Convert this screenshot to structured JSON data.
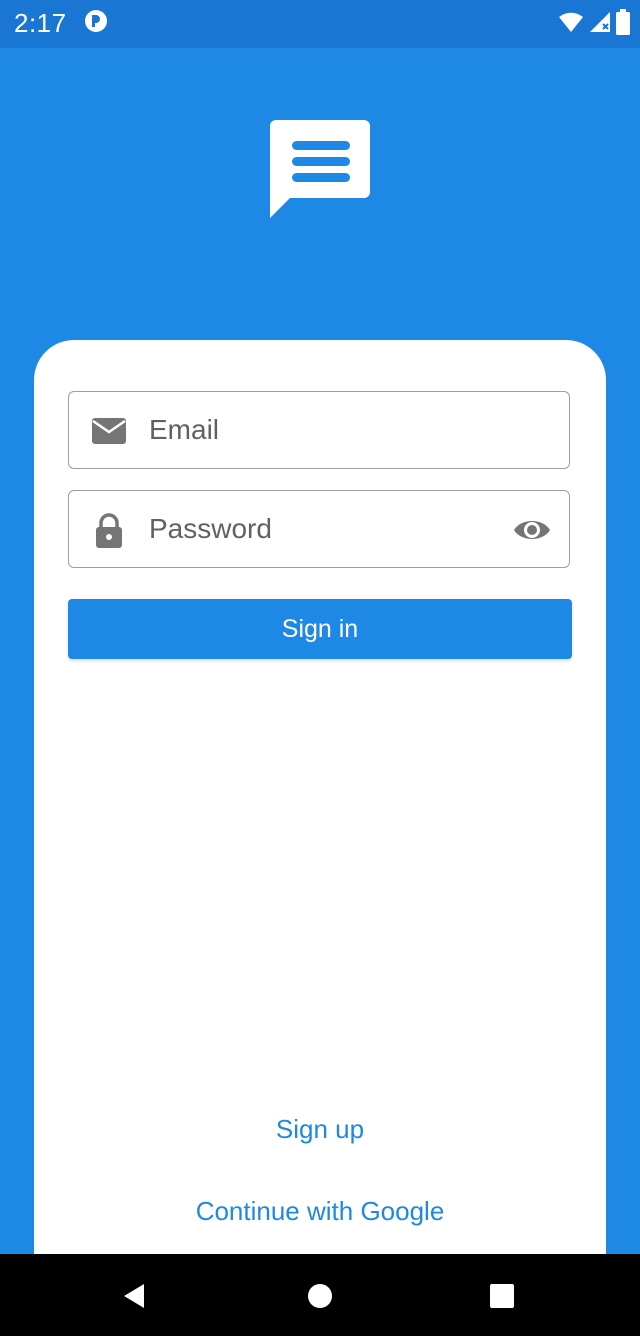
{
  "status_bar": {
    "time": "2:17",
    "app_icon": "app-notification-icon",
    "wifi_icon": "wifi-icon",
    "signal_icon": "signal-icon",
    "battery_icon": "battery-icon"
  },
  "logo": {
    "icon": "chat-bubble-icon"
  },
  "form": {
    "email": {
      "placeholder": "Email",
      "value": "",
      "icon": "mail-icon"
    },
    "password": {
      "placeholder": "Password",
      "value": "",
      "icon": "lock-icon",
      "toggle_icon": "eye-icon"
    },
    "sign_in_label": "Sign in"
  },
  "links": {
    "sign_up": "Sign up",
    "google": "Continue with Google"
  },
  "nav": {
    "back_icon": "back-icon",
    "home_icon": "home-icon",
    "recents_icon": "recents-icon"
  },
  "colors": {
    "primary": "#1E88E5",
    "status_bar": "#1976D2",
    "card": "#FFFFFF",
    "nav_bar": "#000000"
  }
}
